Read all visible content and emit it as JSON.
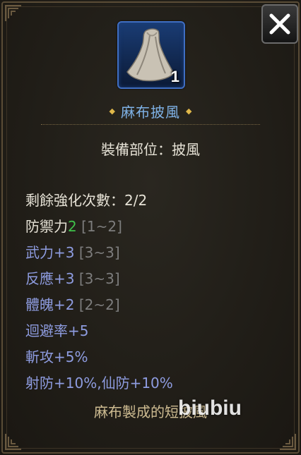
{
  "item": {
    "icon": "cloak-icon",
    "count": "1",
    "name": "麻布披風",
    "name_color": "#7fb2e6",
    "frame_color": "#3f6ec2"
  },
  "slot": {
    "label": "裝備部位：",
    "value": "披風"
  },
  "stats": {
    "refine": {
      "label": "剩餘強化次數：",
      "value": "2/2"
    },
    "defense": {
      "label": "防禦力",
      "value": "2",
      "range": "[1~2]"
    },
    "strength": {
      "label": "武力+3",
      "range": "[3~3]"
    },
    "reaction": {
      "label": "反應+3",
      "range": "[3~3]"
    },
    "physique": {
      "label": "體魄+2",
      "range": "[2~2]"
    },
    "evasion": {
      "label": "迴避率+5"
    },
    "slash": {
      "label": "斬攻+5%"
    },
    "resist": {
      "label": "射防+10%,仙防+10%"
    }
  },
  "description": "麻布製成的短披風",
  "watermark": {
    "text": "biubiu",
    "icon": "watermark-logo-icon"
  },
  "close_button": {
    "icon": "close-icon"
  },
  "colors": {
    "highlight_green": "#3fc24a",
    "bonus_blue": "#8e9ce0",
    "range_gray": "#7d7d7d",
    "description_tan": "#cdbb91"
  }
}
